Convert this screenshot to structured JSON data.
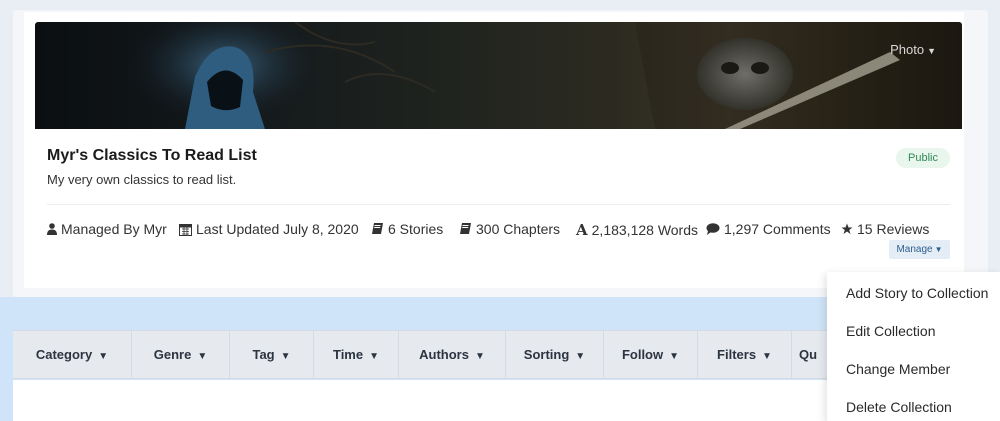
{
  "banner": {
    "photo_label": "Photo",
    "photo_caret": "▼"
  },
  "collection": {
    "title": "Myr's Classics To Read List",
    "description": "My very own classics to read list.",
    "visibility": "Public"
  },
  "meta": {
    "managed_by": "Managed By Myr",
    "last_updated": "Last Updated July 8, 2020",
    "stories": "6 Stories",
    "chapters": "300 Chapters",
    "words": "2,183,128 Words",
    "comments": "1,297 Comments",
    "reviews": "15 Reviews",
    "words_glyph": "A"
  },
  "manage": {
    "label": "Manage",
    "caret": "▼"
  },
  "filters": {
    "caret": "▼",
    "tabs": [
      "Category",
      "Genre",
      "Tag",
      "Time",
      "Authors",
      "Sorting",
      "Follow",
      "Filters",
      "Qu"
    ]
  },
  "dropdown": {
    "items": [
      "Add Story to Collection",
      "Edit Collection",
      "Change Member",
      "Delete Collection"
    ]
  },
  "icons": {
    "managed_by": "user-icon",
    "last_updated": "calendar-icon",
    "stories": "book-icon",
    "chapters": "book-icon",
    "words": "font-icon",
    "comments": "comment-icon",
    "reviews": "star-icon"
  },
  "colors": {
    "page_bg": "#cfe4f8",
    "badge_bg": "#e8f6ee",
    "badge_text": "#2f8a55",
    "manage_bg": "#e4edf6",
    "manage_text": "#2d5f8f",
    "filter_bar_bg": "#e6eaef"
  }
}
